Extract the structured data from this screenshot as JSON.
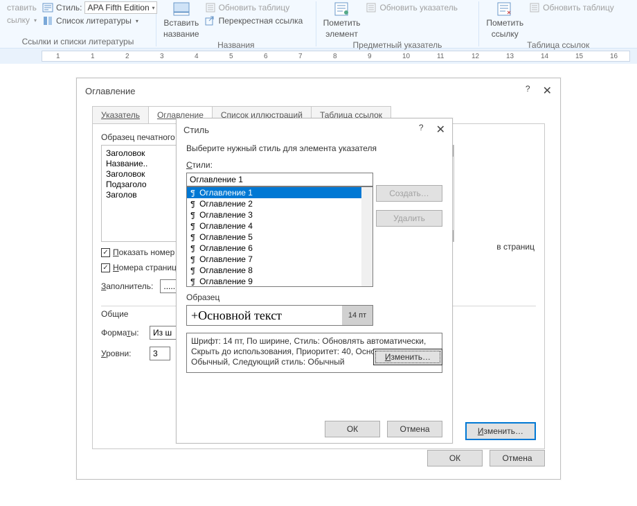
{
  "ribbon": {
    "group1": {
      "style_label": "Стиль:",
      "style_value": "APA Fifth Edition",
      "biblio_label": "Список литературы",
      "insert_link_top": "ставить",
      "insert_link_bottom": "сылку",
      "title": "Ссылки и списки литературы"
    },
    "group2": {
      "insert_caption_top": "Вставить",
      "insert_caption_bottom": "название",
      "update_table": "Обновить таблицу",
      "cross_ref": "Перекрестная ссылка",
      "title": "Названия"
    },
    "group3": {
      "mark_top": "Пометить",
      "mark_bottom": "элемент",
      "update_index": "Обновить указатель",
      "title": "Предметный указатель"
    },
    "group4": {
      "mark_top": "Пометить",
      "mark_bottom": "ссылку",
      "update_table": "Обновить таблицу",
      "title": "Таблица ссылок"
    }
  },
  "ruler_ticks": [
    "1",
    "1",
    "2",
    "3",
    "4",
    "5",
    "6",
    "7",
    "8",
    "9",
    "10",
    "11",
    "12",
    "13",
    "14",
    "15",
    "16"
  ],
  "outer": {
    "title": "Оглавление",
    "tabs": [
      "Указатель",
      "Оглавление",
      "Список иллюстраций",
      "Таблица ссылок"
    ],
    "active_tab": 1,
    "preview_label": "Образец печатного",
    "preview_lines": [
      "Заголовок",
      "Название..",
      "Заголовок",
      "Подзаголо",
      "    Заголов"
    ],
    "pages_suffix": "в страниц",
    "show_pages": "Показать номер",
    "right_align": "Номера страниц",
    "filler_label": "Заполнитель:",
    "filler_value": ".....",
    "general": "Общие",
    "formats_label": "Форматы:",
    "formats_value": "Из ш",
    "levels_label": "Уровни:",
    "levels_value": "3",
    "modify": "Изменить…",
    "ok": "ОК",
    "cancel": "Отмена"
  },
  "inner": {
    "title": "Стиль",
    "instruction": "Выберите нужный стиль для элемента указателя",
    "list_label": "Стили:",
    "input_value": "Оглавление 1",
    "items": [
      "Оглавление 1",
      "Оглавление 2",
      "Оглавление 3",
      "Оглавление 4",
      "Оглавление 5",
      "Оглавление 6",
      "Оглавление 7",
      "Оглавление 8",
      "Оглавление 9"
    ],
    "selected": 0,
    "create": "Создать…",
    "delete": "Удалить",
    "sample_label": "Образец",
    "sample_text": "+Основной текст",
    "sample_size": "14 пт",
    "modify": "Изменить…",
    "description": "Шрифт: 14 пт, По ширине, Стиль: Обновлять автоматически, Скрыть до использования, Приоритет: 40, Основан на стиле: Обычный, Следующий стиль: Обычный",
    "ok": "ОК",
    "cancel": "Отмена"
  }
}
